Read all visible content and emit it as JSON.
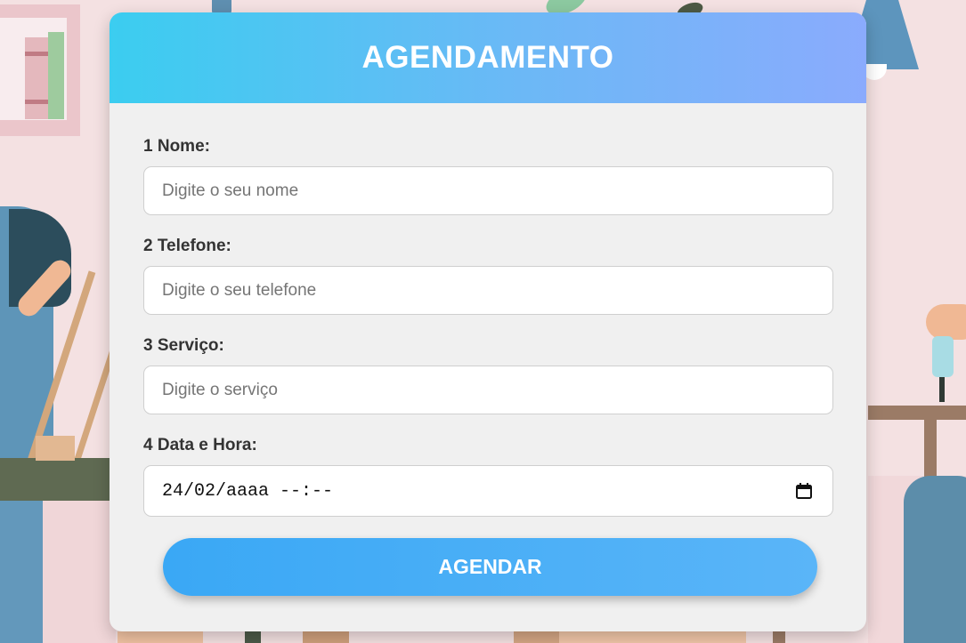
{
  "header": {
    "title": "AGENDAMENTO"
  },
  "form": {
    "fields": [
      {
        "label": "1 Nome:",
        "placeholder": "Digite o seu nome",
        "value": ""
      },
      {
        "label": "2 Telefone:",
        "placeholder": "Digite o seu telefone",
        "value": ""
      },
      {
        "label": "3 Serviço:",
        "placeholder": "Digite o serviço",
        "value": ""
      },
      {
        "label": "4 Data e Hora:",
        "value": "24/02/aaaa --:--",
        "icon": "calendar-icon"
      }
    ],
    "submit_label": "AGENDAR"
  },
  "colors": {
    "header_gradient_start": "#3bcdf0",
    "header_gradient_end": "#8aabfd",
    "button_gradient_start": "#3aa8f5",
    "button_gradient_end": "#5ab5f8",
    "card_background": "#f0f0f0",
    "page_background": "#f4e1e2"
  }
}
